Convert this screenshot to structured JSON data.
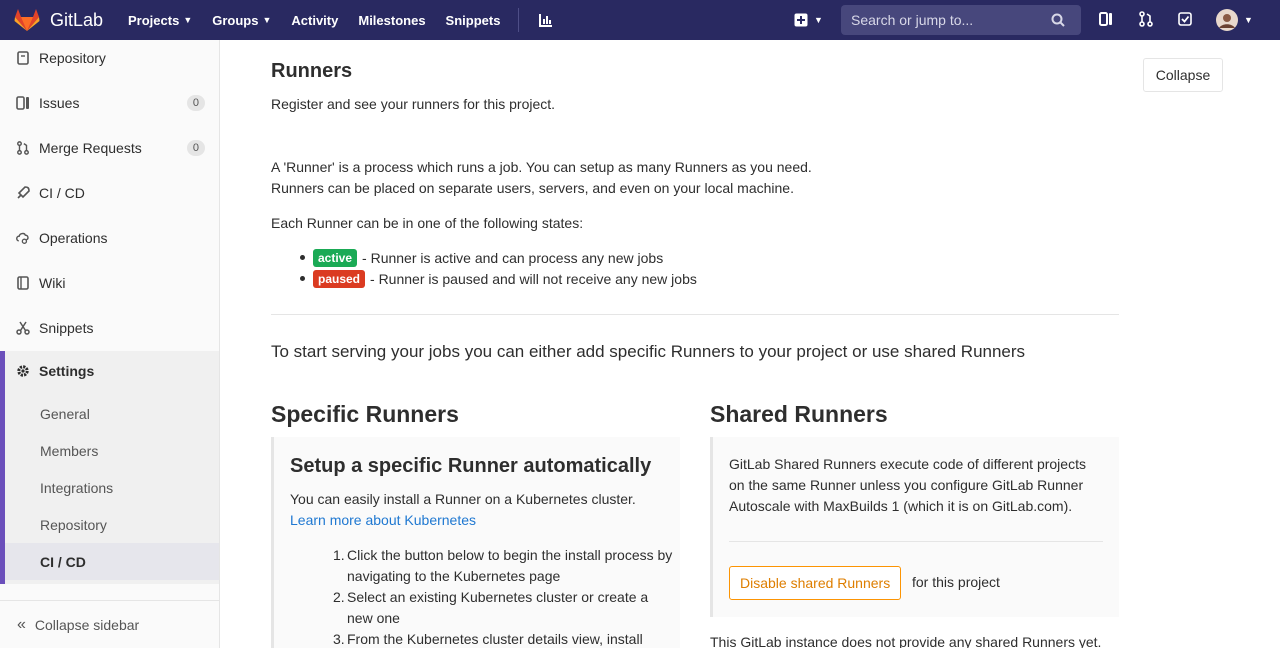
{
  "navbar": {
    "brand": "GitLab",
    "links": [
      "Projects",
      "Groups",
      "Activity",
      "Milestones",
      "Snippets"
    ],
    "search_placeholder": "Search or jump to..."
  },
  "sidebar": {
    "items": [
      {
        "label": "Repository",
        "icon": "repository-icon"
      },
      {
        "label": "Issues",
        "icon": "issues-icon",
        "count": "0"
      },
      {
        "label": "Merge Requests",
        "icon": "merge-request-icon",
        "count": "0"
      },
      {
        "label": "CI / CD",
        "icon": "rocket-icon"
      },
      {
        "label": "Operations",
        "icon": "cloud-gear-icon"
      },
      {
        "label": "Wiki",
        "icon": "book-icon"
      },
      {
        "label": "Snippets",
        "icon": "scissors-icon"
      }
    ],
    "settings_label": "Settings",
    "settings_sub": [
      "General",
      "Members",
      "Integrations",
      "Repository",
      "CI / CD"
    ],
    "collapse_label": "Collapse sidebar"
  },
  "runners": {
    "title": "Runners",
    "collapse_label": "Collapse",
    "intro": "Register and see your runners for this project.",
    "desc_line1": "A 'Runner' is a process which runs a job. You can setup as many Runners as you need.",
    "desc_line2": "Runners can be placed on separate users, servers, and even on your local machine.",
    "states_intro": "Each Runner can be in one of the following states:",
    "states": [
      {
        "label": "active",
        "text": "- Runner is active and can process any new jobs",
        "color": "#1aaa55"
      },
      {
        "label": "paused",
        "text": "- Runner is paused and will not receive any new jobs",
        "color": "#db3b21"
      }
    ],
    "lead": "To start serving your jobs you can either add specific Runners to your project or use shared Runners"
  },
  "specific": {
    "heading": "Specific Runners",
    "panel_title": "Setup a specific Runner automatically",
    "panel_text": "You can easily install a Runner on a Kubernetes cluster.",
    "panel_link": "Learn more about Kubernetes",
    "steps": [
      "Click the button below to begin the install process by navigating to the Kubernetes page",
      "Select an existing Kubernetes cluster or create a new one",
      "From the Kubernetes cluster details view, install"
    ]
  },
  "shared": {
    "heading": "Shared Runners",
    "text_line1": "GitLab Shared Runners execute code of different projects",
    "text_line2": "on the same Runner unless you configure GitLab Runner",
    "text_line3": "Autoscale with MaxBuilds 1 (which it is on GitLab.com).",
    "button_label": "Disable shared Runners",
    "button_suffix": "for this project",
    "bottom_note": "This GitLab instance does not provide any shared Runners yet."
  }
}
